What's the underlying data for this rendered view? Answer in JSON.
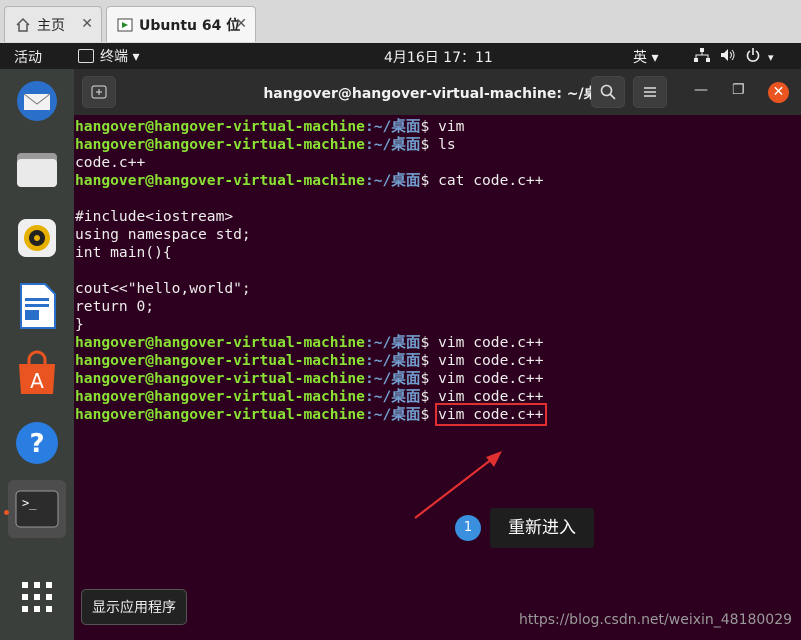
{
  "host": {
    "tabs": [
      {
        "label": "主页",
        "icon": "home-icon"
      },
      {
        "label": "Ubuntu 64 位",
        "icon": "vm-icon"
      }
    ],
    "close_glyph": "✕"
  },
  "topbar": {
    "activities": "活动",
    "app_menu": "终端 ▾",
    "clock": "4月16日  17：11",
    "input_method": "英 ▾"
  },
  "dock": {
    "items": [
      "thunderbird-icon",
      "files-icon",
      "rhythmbox-icon",
      "writer-icon",
      "software-icon",
      "help-icon",
      "terminal-icon",
      "apps-grid-icon"
    ],
    "tooltip": "显示应用程序"
  },
  "window": {
    "title": "hangover@hangover-virtual-machine: ~/桌面",
    "minimize": "—",
    "maximize": "❐",
    "close": "✕"
  },
  "terminal": {
    "user": "hangover@hangover-virtual-machine",
    "path": ":~/桌面",
    "lines": [
      {
        "type": "prompt",
        "cmd": "$ vim"
      },
      {
        "type": "prompt",
        "cmd": "$ ls"
      },
      {
        "type": "out",
        "text": "code.c++"
      },
      {
        "type": "prompt",
        "cmd": "$ cat code.c++"
      },
      {
        "type": "out",
        "text": ""
      },
      {
        "type": "out",
        "text": "#include<iostream>"
      },
      {
        "type": "out",
        "text": "using namespace std;"
      },
      {
        "type": "out",
        "text": "int main(){"
      },
      {
        "type": "out",
        "text": ""
      },
      {
        "type": "out",
        "text": "cout<<\"hello,world\";"
      },
      {
        "type": "out",
        "text": "return 0;"
      },
      {
        "type": "out",
        "text": "}"
      },
      {
        "type": "prompt",
        "cmd": "$ vim code.c++"
      },
      {
        "type": "prompt",
        "cmd": "$ vim code.c++"
      },
      {
        "type": "prompt",
        "cmd": "$ vim code.c++"
      },
      {
        "type": "prompt",
        "cmd": "$ vim code.c++"
      },
      {
        "type": "prompt",
        "cmd": "$ ",
        "highlight": "vim code.c++"
      }
    ]
  },
  "annotation": {
    "number": "1",
    "text": "重新进入"
  },
  "watermark": "https://blog.csdn.net/weixin_48180029",
  "colors": {
    "terminal_bg": "#2c001e",
    "user": "#8ae234",
    "path": "#729fcf",
    "accent": "#e95420"
  }
}
